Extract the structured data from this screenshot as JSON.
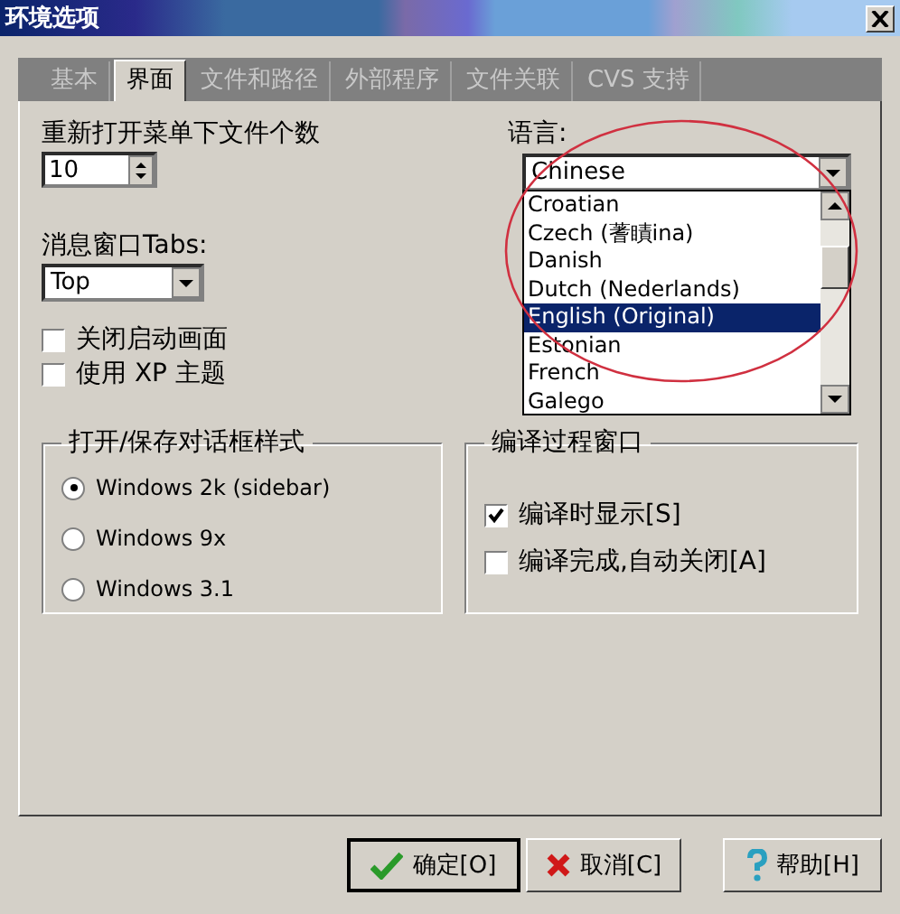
{
  "window": {
    "title": "环境选项"
  },
  "tabs": [
    {
      "label": "基本",
      "selected": false
    },
    {
      "label": "界面",
      "selected": true
    },
    {
      "label": "文件和路径",
      "selected": false
    },
    {
      "label": "外部程序",
      "selected": false
    },
    {
      "label": "文件关联",
      "selected": false
    },
    {
      "label": "CVS 支持",
      "selected": false
    }
  ],
  "recent_files": {
    "label": "重新打开菜单下文件个数",
    "value": "10"
  },
  "message_tabs": {
    "label": "消息窗口Tabs:",
    "value": "Top"
  },
  "checkboxes": [
    {
      "label": "关闭启动画面",
      "checked": false
    },
    {
      "label": "使用 XP 主题",
      "checked": false
    }
  ],
  "language": {
    "label": "语言:",
    "value": "Chinese",
    "options": [
      {
        "label": "Croatian",
        "selected": false
      },
      {
        "label": "Czech (蓍瞔ina)",
        "selected": false
      },
      {
        "label": "Danish",
        "selected": false
      },
      {
        "label": "Dutch (Nederlands)",
        "selected": false
      },
      {
        "label": "English (Original)",
        "selected": true
      },
      {
        "label": "Estonian",
        "selected": false
      },
      {
        "label": "French",
        "selected": false
      },
      {
        "label": "Galego",
        "selected": false
      }
    ]
  },
  "dialog_style": {
    "title": "打开/保存对话框样式",
    "options": [
      {
        "label": "Windows 2k (sidebar)",
        "selected": true
      },
      {
        "label": "Windows 9x",
        "selected": false
      },
      {
        "label": "Windows 3.1",
        "selected": false
      }
    ]
  },
  "compile_window": {
    "title": "编译过程窗口",
    "options": [
      {
        "label": "编译时显示[S]",
        "checked": true
      },
      {
        "label": "编译完成,自动关闭[A]",
        "checked": false
      }
    ]
  },
  "buttons": [
    {
      "label": "确定[O]",
      "kind": "ok"
    },
    {
      "label": "取消[C]",
      "kind": "cancel"
    },
    {
      "label": "帮助[H]",
      "kind": "help"
    }
  ]
}
